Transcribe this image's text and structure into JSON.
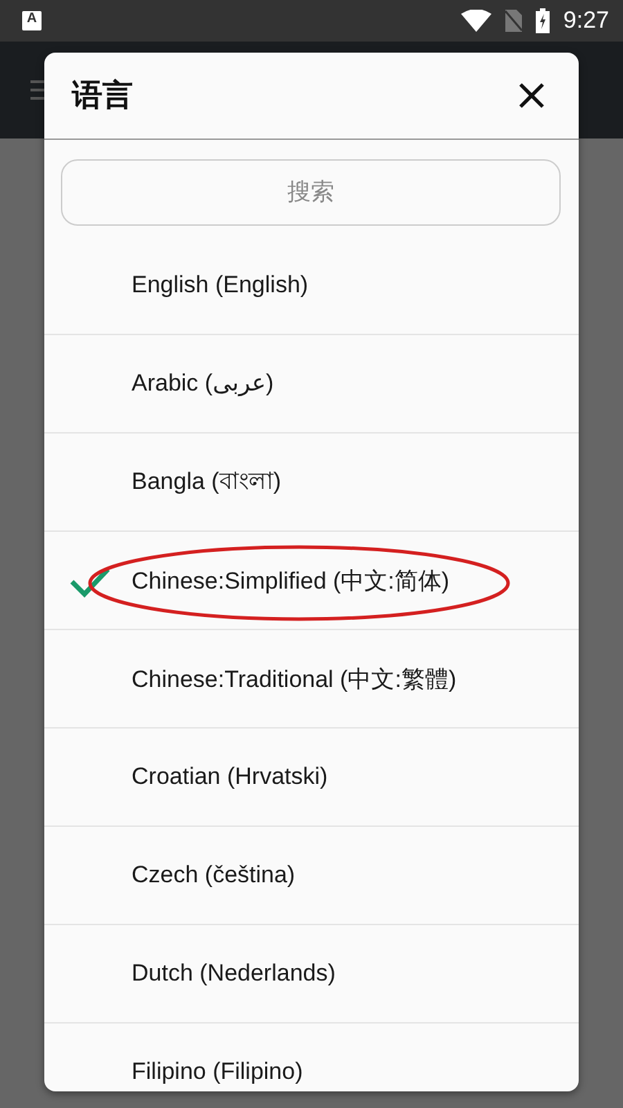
{
  "status_bar": {
    "app_icon_letter": "A",
    "time": "9:27"
  },
  "dialog": {
    "title": "语言",
    "search": {
      "placeholder": "搜索"
    },
    "languages": [
      {
        "label": "English (English)",
        "selected": false,
        "circled": false
      },
      {
        "label": "Arabic (عربى)",
        "selected": false,
        "circled": false
      },
      {
        "label": "Bangla (বাংলা)",
        "selected": false,
        "circled": false
      },
      {
        "label": "Chinese:Simplified (中文:简体)",
        "selected": true,
        "circled": true
      },
      {
        "label": "Chinese:Traditional (中文:繁體)",
        "selected": false,
        "circled": false
      },
      {
        "label": "Croatian (Hrvatski)",
        "selected": false,
        "circled": false
      },
      {
        "label": "Czech (čeština)",
        "selected": false,
        "circled": false
      },
      {
        "label": "Dutch (Nederlands)",
        "selected": false,
        "circled": false
      },
      {
        "label": "Filipino (Filipino)",
        "selected": false,
        "circled": false
      }
    ]
  }
}
